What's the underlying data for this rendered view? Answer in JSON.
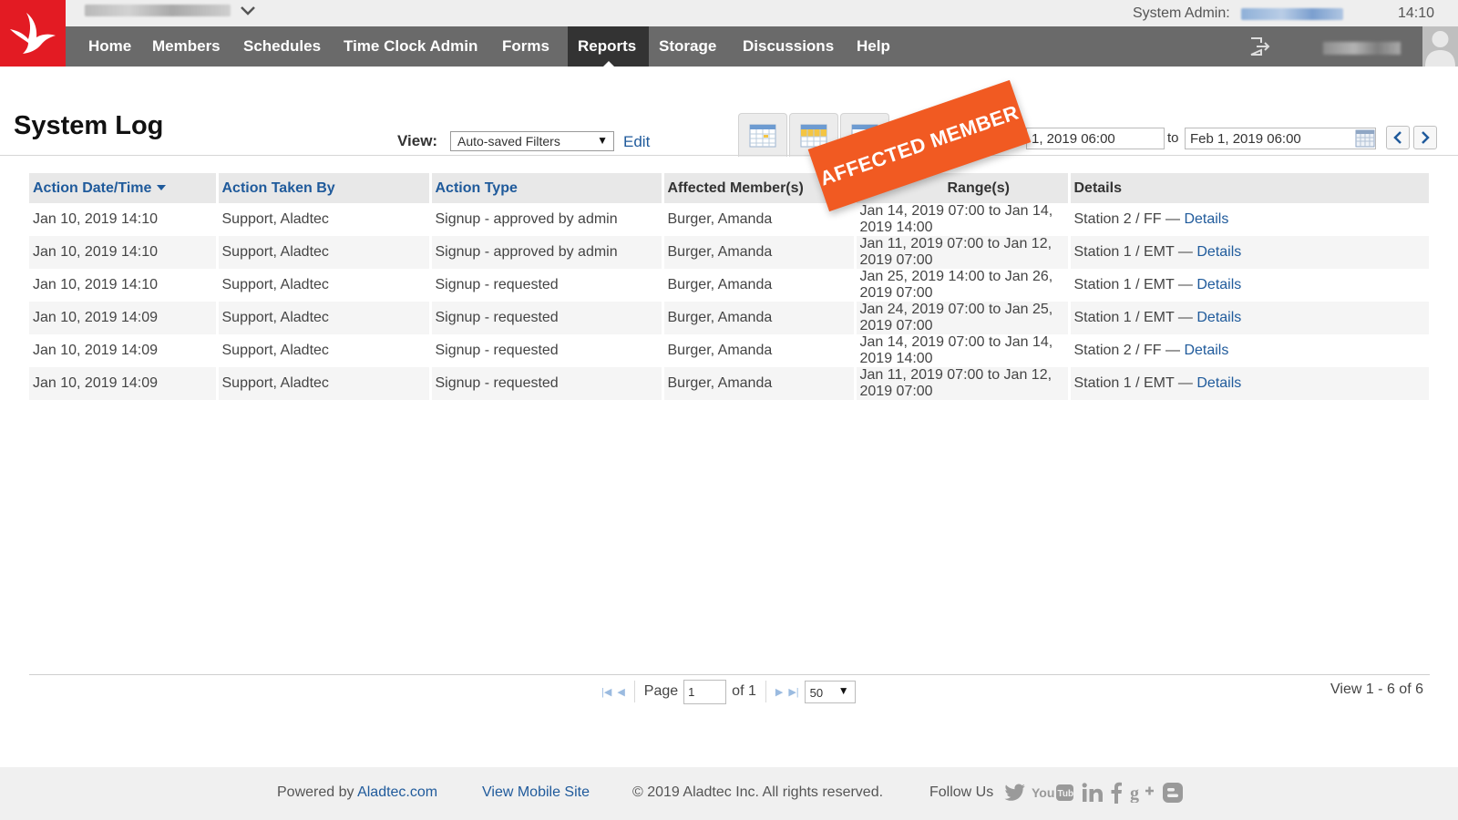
{
  "header": {
    "admin_label": "System Admin:",
    "clock": "14:10"
  },
  "nav": {
    "items": [
      {
        "label": "Home"
      },
      {
        "label": "Members"
      },
      {
        "label": "Schedules"
      },
      {
        "label": "Time Clock Admin"
      },
      {
        "label": "Forms"
      },
      {
        "label": "Reports"
      },
      {
        "label": "Storage"
      },
      {
        "label": "Discussions"
      },
      {
        "label": "Help"
      }
    ],
    "active": "Reports"
  },
  "page": {
    "title": "System Log",
    "view_label": "View:",
    "view_selected": "Auto-saved Filters",
    "edit_label": "Edit",
    "date_from": "1, 2019 06:00",
    "to_label": "to",
    "date_to": "Feb 1, 2019 06:00"
  },
  "banner": {
    "text": "AFFECTED MEMBER"
  },
  "table": {
    "columns": [
      {
        "label": "Action Date/Time"
      },
      {
        "label": "Action Taken By"
      },
      {
        "label": "Action Type"
      },
      {
        "label": "Affected Member(s)"
      },
      {
        "label": "Range(s)"
      },
      {
        "label": "Details"
      }
    ],
    "rows": [
      {
        "date": "Jan 10, 2019 14:10",
        "by": "Support, Aladtec",
        "type": "Signup - approved by admin",
        "member": "Burger, Amanda",
        "range": "Jan 14, 2019 07:00 to Jan 14, 2019 14:00",
        "detail": "Station 2 / FF —",
        "link": "Details"
      },
      {
        "date": "Jan 10, 2019 14:10",
        "by": "Support, Aladtec",
        "type": "Signup - approved by admin",
        "member": "Burger, Amanda",
        "range": "Jan 11, 2019 07:00 to Jan 12, 2019 07:00",
        "detail": "Station 1 / EMT —",
        "link": "Details"
      },
      {
        "date": "Jan 10, 2019 14:10",
        "by": "Support, Aladtec",
        "type": "Signup - requested",
        "member": "Burger, Amanda",
        "range": "Jan 25, 2019 14:00 to Jan 26, 2019 07:00",
        "detail": "Station 1 / EMT —",
        "link": "Details"
      },
      {
        "date": "Jan 10, 2019 14:09",
        "by": "Support, Aladtec",
        "type": "Signup - requested",
        "member": "Burger, Amanda",
        "range": "Jan 24, 2019 07:00 to Jan 25, 2019 07:00",
        "detail": "Station 1 / EMT —",
        "link": "Details"
      },
      {
        "date": "Jan 10, 2019 14:09",
        "by": "Support, Aladtec",
        "type": "Signup - requested",
        "member": "Burger, Amanda",
        "range": "Jan 14, 2019 07:00 to Jan 14, 2019 14:00",
        "detail": "Station 2 / FF —",
        "link": "Details"
      },
      {
        "date": "Jan 10, 2019 14:09",
        "by": "Support, Aladtec",
        "type": "Signup - requested",
        "member": "Burger, Amanda",
        "range": "Jan 11, 2019 07:00 to Jan 12, 2019 07:00",
        "detail": "Station 1 / EMT —",
        "link": "Details"
      }
    ]
  },
  "pager": {
    "page_label": "Page",
    "page_value": "1",
    "of_label": "of 1",
    "rows_value": "50",
    "view_count": "View 1 - 6 of 6"
  },
  "footer": {
    "powered_prefix": "Powered by",
    "powered_link": "Aladtec.com",
    "mobile_link": "View Mobile Site",
    "copyright": "© 2019 Aladtec Inc. All rights reserved.",
    "follow_label": "Follow Us"
  },
  "colors": {
    "brand_red": "#e31b23",
    "nav_gray": "#6a6a6a",
    "nav_active": "#333333",
    "link_blue": "#1f5a9b",
    "banner_orange": "#f15a22"
  },
  "icons": [
    "bird-logo-icon",
    "chevron-down-icon",
    "logout-icon",
    "user-avatar-icon",
    "calendar-month-icon",
    "calendar-week-icon",
    "calendar-icon",
    "chevron-left-icon",
    "chevron-right-icon",
    "first-page-icon",
    "prev-page-icon",
    "next-page-icon",
    "last-page-icon",
    "twitter-icon",
    "youtube-icon",
    "linkedin-icon",
    "facebook-icon",
    "google-plus-icon",
    "blogger-icon"
  ]
}
